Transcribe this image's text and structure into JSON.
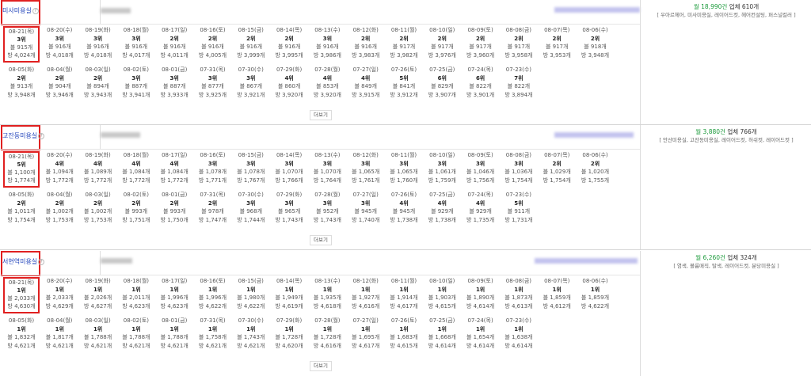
{
  "info_icon": "?",
  "sections": [
    {
      "keyword": "미사미용실",
      "stats_count": "월 18,990건",
      "stats_biz": "업체 610개",
      "tags": "[ 우아르헤어, 미사미용실, 레이어드컷, 헤어컨설팅, 퍼스널컬러 ]",
      "more_label": "더보기",
      "rows": [
        [
          {
            "date": "08-21(목)",
            "rank": "3위",
            "a": "블 915개",
            "b": "방 4,024개"
          },
          {
            "date": "08-20(수)",
            "rank": "3위",
            "a": "블 916개",
            "b": "방 4,018개"
          },
          {
            "date": "08-19(화)",
            "rank": "3위",
            "a": "블 916개",
            "b": "방 4,018개"
          },
          {
            "date": "08-18(월)",
            "rank": "3위",
            "a": "블 916개",
            "b": "방 4,017개"
          },
          {
            "date": "08-17(일)",
            "rank": "2위",
            "a": "블 916개",
            "b": "방 4,011개"
          },
          {
            "date": "08-16(토)",
            "rank": "2위",
            "a": "블 916개",
            "b": "방 4,005개"
          },
          {
            "date": "08-15(금)",
            "rank": "2위",
            "a": "블 916개",
            "b": "방 3,999개"
          },
          {
            "date": "08-14(목)",
            "rank": "2위",
            "a": "블 916개",
            "b": "방 3,995개"
          },
          {
            "date": "08-13(수)",
            "rank": "3위",
            "a": "블 916개",
            "b": "방 3,986개"
          },
          {
            "date": "08-12(화)",
            "rank": "2위",
            "a": "블 916개",
            "b": "방 3,983개"
          },
          {
            "date": "08-11(월)",
            "rank": "2위",
            "a": "블 917개",
            "b": "방 3,982개"
          },
          {
            "date": "08-10(일)",
            "rank": "2위",
            "a": "블 917개",
            "b": "방 3,976개"
          },
          {
            "date": "08-09(토)",
            "rank": "2위",
            "a": "블 917개",
            "b": "방 3,960개"
          },
          {
            "date": "08-08(금)",
            "rank": "2위",
            "a": "블 917개",
            "b": "방 3,958개"
          },
          {
            "date": "08-07(목)",
            "rank": "2위",
            "a": "블 917개",
            "b": "방 3,953개"
          },
          {
            "date": "08-06(수)",
            "rank": "2위",
            "a": "블 918개",
            "b": "방 3,948개"
          }
        ],
        [
          {
            "date": "08-05(화)",
            "rank": "2위",
            "a": "블 913개",
            "b": "방 3,948개"
          },
          {
            "date": "08-04(월)",
            "rank": "2위",
            "a": "블 904개",
            "b": "방 3,946개"
          },
          {
            "date": "08-03(일)",
            "rank": "2위",
            "a": "블 894개",
            "b": "방 3,943개"
          },
          {
            "date": "08-02(토)",
            "rank": "3위",
            "a": "블 887개",
            "b": "방 3,941개"
          },
          {
            "date": "08-01(금)",
            "rank": "3위",
            "a": "블 887개",
            "b": "방 3,933개"
          },
          {
            "date": "07-31(목)",
            "rank": "3위",
            "a": "블 877개",
            "b": "방 3,925개"
          },
          {
            "date": "07-30(수)",
            "rank": "3위",
            "a": "블 867개",
            "b": "방 3,921개"
          },
          {
            "date": "07-29(화)",
            "rank": "4위",
            "a": "블 860개",
            "b": "방 3,920개"
          },
          {
            "date": "07-28(월)",
            "rank": "4위",
            "a": "블 853개",
            "b": "방 3,920개"
          },
          {
            "date": "07-27(일)",
            "rank": "4위",
            "a": "블 849개",
            "b": "방 3,915개"
          },
          {
            "date": "07-26(토)",
            "rank": "5위",
            "a": "블 841개",
            "b": "방 3,912개"
          },
          {
            "date": "07-25(금)",
            "rank": "6위",
            "a": "블 829개",
            "b": "방 3,907개"
          },
          {
            "date": "07-24(목)",
            "rank": "6위",
            "a": "블 822개",
            "b": "방 3,901개"
          },
          {
            "date": "07-23(수)",
            "rank": "7위",
            "a": "블 822개",
            "b": "방 3,894개"
          }
        ]
      ]
    },
    {
      "keyword": "고잔동미용실",
      "stats_count": "월 3,880건",
      "stats_biz": "업체 766개",
      "tags": "[ 안산미용실, 고잔동미용실, 레이어드컷, 허쉬컷, 레이어드컷 ]",
      "more_label": "더보기",
      "rows": [
        [
          {
            "date": "08-21(목)",
            "rank": "5위",
            "a": "블 1,100개",
            "b": "방 1,774개"
          },
          {
            "date": "08-20(수)",
            "rank": "4위",
            "a": "블 1,094개",
            "b": "방 1,772개"
          },
          {
            "date": "08-19(화)",
            "rank": "4위",
            "a": "블 1,089개",
            "b": "방 1,772개"
          },
          {
            "date": "08-18(월)",
            "rank": "4위",
            "a": "블 1,084개",
            "b": "방 1,772개"
          },
          {
            "date": "08-17(일)",
            "rank": "4위",
            "a": "블 1,084개",
            "b": "방 1,772개"
          },
          {
            "date": "08-16(토)",
            "rank": "3위",
            "a": "블 1,078개",
            "b": "방 1,771개"
          },
          {
            "date": "08-15(금)",
            "rank": "3위",
            "a": "블 1,078개",
            "b": "방 1,767개"
          },
          {
            "date": "08-14(목)",
            "rank": "3위",
            "a": "블 1,070개",
            "b": "방 1,766개"
          },
          {
            "date": "08-13(수)",
            "rank": "3위",
            "a": "블 1,070개",
            "b": "방 1,764개"
          },
          {
            "date": "08-12(화)",
            "rank": "3위",
            "a": "블 1,065개",
            "b": "방 1,761개"
          },
          {
            "date": "08-11(월)",
            "rank": "3위",
            "a": "블 1,065개",
            "b": "방 1,760개"
          },
          {
            "date": "08-10(일)",
            "rank": "3위",
            "a": "블 1,061개",
            "b": "방 1,759개"
          },
          {
            "date": "08-09(토)",
            "rank": "3위",
            "a": "블 1,046개",
            "b": "방 1,756개"
          },
          {
            "date": "08-08(금)",
            "rank": "3위",
            "a": "블 1,036개",
            "b": "방 1,754개"
          },
          {
            "date": "08-07(목)",
            "rank": "2위",
            "a": "블 1,029개",
            "b": "방 1,754개"
          },
          {
            "date": "08-06(수)",
            "rank": "2위",
            "a": "블 1,020개",
            "b": "방 1,755개"
          }
        ],
        [
          {
            "date": "08-05(화)",
            "rank": "2위",
            "a": "블 1,011개",
            "b": "방 1,754개"
          },
          {
            "date": "08-04(월)",
            "rank": "2위",
            "a": "블 1,002개",
            "b": "방 1,753개"
          },
          {
            "date": "08-03(일)",
            "rank": "2위",
            "a": "블 1,002개",
            "b": "방 1,753개"
          },
          {
            "date": "08-02(토)",
            "rank": "2위",
            "a": "블 993개",
            "b": "방 1,751개"
          },
          {
            "date": "08-01(금)",
            "rank": "2위",
            "a": "블 993개",
            "b": "방 1,750개"
          },
          {
            "date": "07-31(목)",
            "rank": "2위",
            "a": "블 978개",
            "b": "방 1,747개"
          },
          {
            "date": "07-30(수)",
            "rank": "3위",
            "a": "블 968개",
            "b": "방 1,744개"
          },
          {
            "date": "07-29(화)",
            "rank": "3위",
            "a": "블 965개",
            "b": "방 1,743개"
          },
          {
            "date": "07-28(월)",
            "rank": "3위",
            "a": "블 952개",
            "b": "방 1,743개"
          },
          {
            "date": "07-27(일)",
            "rank": "3위",
            "a": "블 945개",
            "b": "방 1,740개"
          },
          {
            "date": "07-26(토)",
            "rank": "4위",
            "a": "블 945개",
            "b": "방 1,738개"
          },
          {
            "date": "07-25(금)",
            "rank": "4위",
            "a": "블 929개",
            "b": "방 1,738개"
          },
          {
            "date": "07-24(목)",
            "rank": "4위",
            "a": "블 929개",
            "b": "방 1,735개"
          },
          {
            "date": "07-23(수)",
            "rank": "5위",
            "a": "블 911개",
            "b": "방 1,731개"
          }
        ]
      ]
    },
    {
      "keyword": "서현역미용실",
      "stats_count": "월 6,260건",
      "stats_biz": "업체 324개",
      "tags": "[ 염색, 볼륨매직, 탈색, 레이어드컷, 분당미용실 ]",
      "more_label": "더보기",
      "rows": [
        [
          {
            "date": "08-21(목)",
            "rank": "1위",
            "a": "블 2,033개",
            "b": "방 4,630개"
          },
          {
            "date": "08-20(수)",
            "rank": "1위",
            "a": "블 2,033개",
            "b": "방 4,629개"
          },
          {
            "date": "08-19(화)",
            "rank": "1위",
            "a": "블 2,026개",
            "b": "방 4,627개"
          },
          {
            "date": "08-18(월)",
            "rank": "1위",
            "a": "블 2,011개",
            "b": "방 4,623개"
          },
          {
            "date": "08-17(일)",
            "rank": "1위",
            "a": "블 1,996개",
            "b": "방 4,623개"
          },
          {
            "date": "08-16(토)",
            "rank": "1위",
            "a": "블 1,996개",
            "b": "방 4,622개"
          },
          {
            "date": "08-15(금)",
            "rank": "1위",
            "a": "블 1,980개",
            "b": "방 4,622개"
          },
          {
            "date": "08-14(목)",
            "rank": "1위",
            "a": "블 1,949개",
            "b": "방 4,619개"
          },
          {
            "date": "08-13(수)",
            "rank": "1위",
            "a": "블 1,935개",
            "b": "방 4,618개"
          },
          {
            "date": "08-12(화)",
            "rank": "1위",
            "a": "블 1,927개",
            "b": "방 4,616개"
          },
          {
            "date": "08-11(월)",
            "rank": "1위",
            "a": "블 1,914개",
            "b": "방 4,617개"
          },
          {
            "date": "08-10(일)",
            "rank": "1위",
            "a": "블 1,903개",
            "b": "방 4,615개"
          },
          {
            "date": "08-09(토)",
            "rank": "1위",
            "a": "블 1,890개",
            "b": "방 4,614개"
          },
          {
            "date": "08-08(금)",
            "rank": "1위",
            "a": "블 1,873개",
            "b": "방 4,613개"
          },
          {
            "date": "08-07(목)",
            "rank": "1위",
            "a": "블 1,859개",
            "b": "방 4,612개"
          },
          {
            "date": "08-06(수)",
            "rank": "1위",
            "a": "블 1,859개",
            "b": "방 4,622개"
          }
        ],
        [
          {
            "date": "08-05(화)",
            "rank": "1위",
            "a": "블 1,832개",
            "b": "방 4,621개"
          },
          {
            "date": "08-04(월)",
            "rank": "1위",
            "a": "블 1,817개",
            "b": "방 4,621개"
          },
          {
            "date": "08-03(일)",
            "rank": "1위",
            "a": "블 1,788개",
            "b": "방 4,621개"
          },
          {
            "date": "08-02(토)",
            "rank": "1위",
            "a": "블 1,788개",
            "b": "방 4,621개"
          },
          {
            "date": "08-01(금)",
            "rank": "1위",
            "a": "블 1,788개",
            "b": "방 4,621개"
          },
          {
            "date": "07-31(목)",
            "rank": "1위",
            "a": "블 1,758개",
            "b": "방 4,621개"
          },
          {
            "date": "07-30(수)",
            "rank": "1위",
            "a": "블 1,743개",
            "b": "방 4,621개"
          },
          {
            "date": "07-29(화)",
            "rank": "1위",
            "a": "블 1,728개",
            "b": "방 4,620개"
          },
          {
            "date": "07-28(월)",
            "rank": "1위",
            "a": "블 1,728개",
            "b": "방 4,616개"
          },
          {
            "date": "07-27(일)",
            "rank": "1위",
            "a": "블 1,695개",
            "b": "방 4,617개"
          },
          {
            "date": "07-26(토)",
            "rank": "1위",
            "a": "블 1,683개",
            "b": "방 4,615개"
          },
          {
            "date": "07-25(금)",
            "rank": "1위",
            "a": "블 1,668개",
            "b": "방 4,614개"
          },
          {
            "date": "07-24(목)",
            "rank": "1위",
            "a": "블 1,654개",
            "b": "방 4,614개"
          },
          {
            "date": "07-23(수)",
            "rank": "1위",
            "a": "블 1,638개",
            "b": "방 4,614개"
          }
        ]
      ]
    }
  ]
}
